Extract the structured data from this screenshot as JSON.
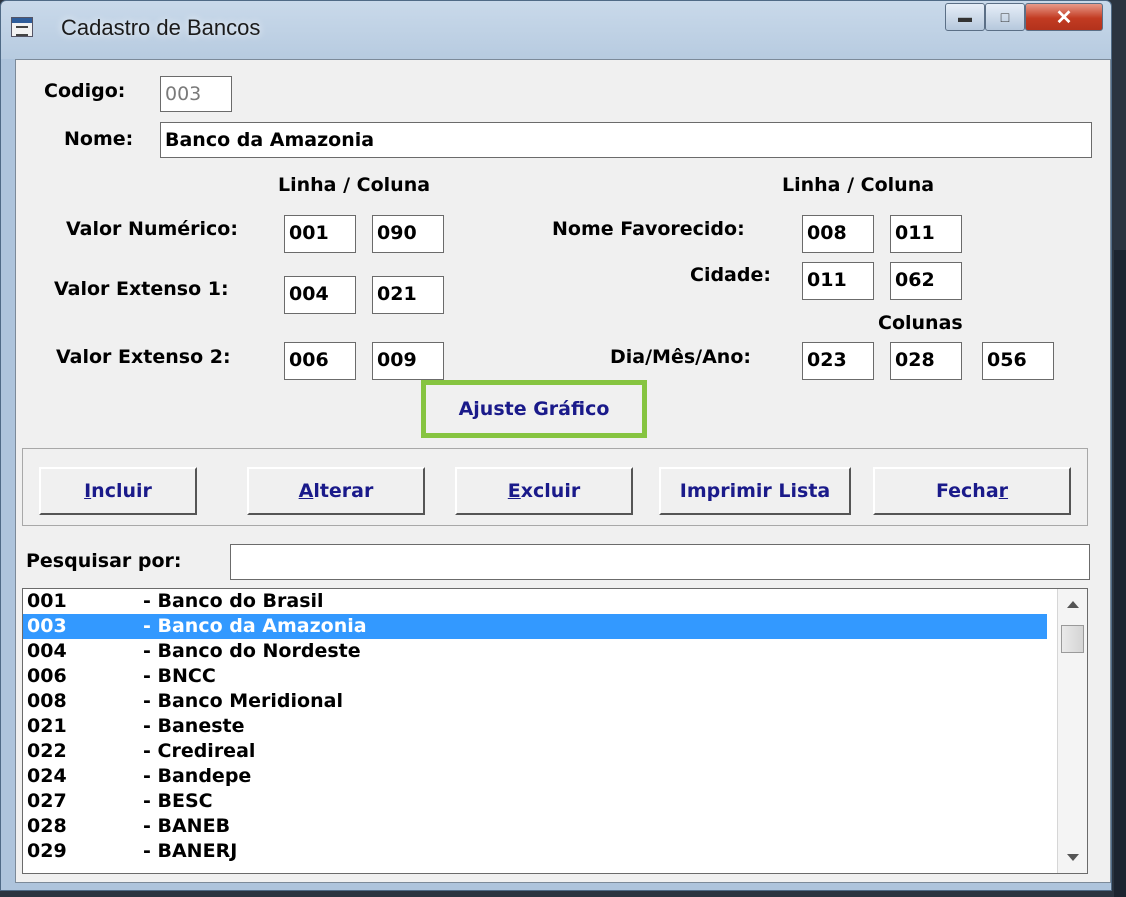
{
  "window": {
    "title": "Cadastro de Bancos"
  },
  "form": {
    "codigo_label": "Codigo:",
    "codigo_value": "003",
    "nome_label": "Nome:",
    "nome_value": "Banco da Amazonia",
    "linha_coluna_left": "Linha / Coluna",
    "linha_coluna_right": "Linha / Coluna",
    "colunas_label": "Colunas",
    "valor_numerico": {
      "label": "Valor Numérico:",
      "linha": "001",
      "coluna": "090"
    },
    "valor_extenso_1": {
      "label": "Valor Extenso 1:",
      "linha": "004",
      "coluna": "021"
    },
    "valor_extenso_2": {
      "label": "Valor Extenso 2:",
      "linha": "006",
      "coluna": "009"
    },
    "nome_favorecido": {
      "label": "Nome Favorecido:",
      "linha": "008",
      "coluna": "011"
    },
    "cidade": {
      "label": "Cidade:",
      "linha": "011",
      "coluna": "062"
    },
    "dia_mes_ano": {
      "label": "Dia/Mês/Ano:",
      "col1": "023",
      "col2": "028",
      "col3": "056"
    },
    "ajuste_label": "Ajuste Gráfico",
    "ajuste_highlight_color": "#86c440"
  },
  "buttons": {
    "incluir": {
      "mnemonic": "I",
      "rest": "ncluir"
    },
    "alterar": {
      "mnemonic": "A",
      "rest": "lterar"
    },
    "excluir": {
      "mnemonic": "E",
      "rest": "xcluir"
    },
    "imprimir": "Imprimir Lista",
    "fechar": {
      "pre": "Fecha",
      "mnemonic": "r"
    }
  },
  "search": {
    "label": "Pesquisar por:",
    "value": ""
  },
  "list": {
    "selection_color": "#3399ff",
    "items": [
      {
        "code": "001",
        "name": "- Banco do Brasil"
      },
      {
        "code": "003",
        "name": "- Banco da Amazonia"
      },
      {
        "code": "004",
        "name": "- Banco do Nordeste"
      },
      {
        "code": "006",
        "name": "- BNCC"
      },
      {
        "code": "008",
        "name": "- Banco Meridional"
      },
      {
        "code": "021",
        "name": "- Baneste"
      },
      {
        "code": "022",
        "name": "- Credireal"
      },
      {
        "code": "024",
        "name": "- Bandepe"
      },
      {
        "code": "027",
        "name": "- BESC"
      },
      {
        "code": "028",
        "name": "- BANEB"
      },
      {
        "code": "029",
        "name": "- BANERJ"
      }
    ]
  }
}
